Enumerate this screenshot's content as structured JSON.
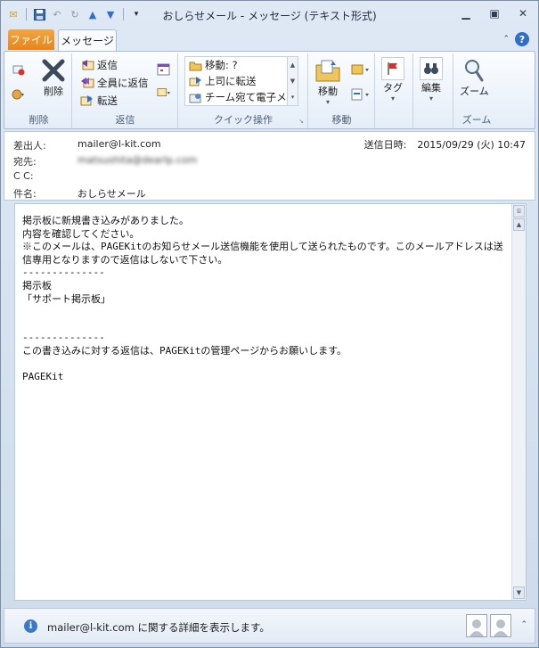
{
  "window": {
    "title": "おしらせメール - メッセージ (テキスト形式)"
  },
  "tabs": {
    "file": "ファイル",
    "message": "メッセージ"
  },
  "ribbon": {
    "delete_group": {
      "label": "削除",
      "delete": "削除"
    },
    "reply_group": {
      "label": "返信",
      "reply": "返信",
      "reply_all": "全員に返信",
      "forward": "転送"
    },
    "quick_group": {
      "label": "クイック操作",
      "items": [
        "移動: ?",
        "上司に転送",
        "チーム宛て電子メ..."
      ]
    },
    "move_group": {
      "label": "移動",
      "move": "移動"
    },
    "tag_group": {
      "tag": "タグ"
    },
    "edit_group": {
      "edit": "編集"
    },
    "zoom_group": {
      "label": "ズーム",
      "zoom": "ズーム"
    }
  },
  "header": {
    "from_label": "差出人:",
    "from_value": "mailer@l-kit.com",
    "to_label": "宛先:",
    "to_value": "matsushita@dearlp.com",
    "cc_label": "C C:",
    "subject_label": "件名:",
    "subject_value": "おしらせメール",
    "sent_label": "送信日時:",
    "sent_value": "2015/09/29 (火) 10:47"
  },
  "body": {
    "text": "掲示板に新規書き込みがありました。\n内容を確認してください。\n※このメールは、PAGEKitのお知らせメール送信機能を使用して送られたものです。このメールアドレスは送信専用となりますので返信はしないで下さい。\n--------------\n掲示板\n「サポート掲示板」\n\n\n--------------\nこの書き込みに対する返信は、PAGEKitの管理ページからお願いします。\n\nPAGEKit"
  },
  "people_pane": {
    "text": "mailer@l-kit.com に関する詳細を表示します。"
  },
  "colors": {
    "file_tab": "#e7861a",
    "accent_blue": "#2f6fc8"
  }
}
